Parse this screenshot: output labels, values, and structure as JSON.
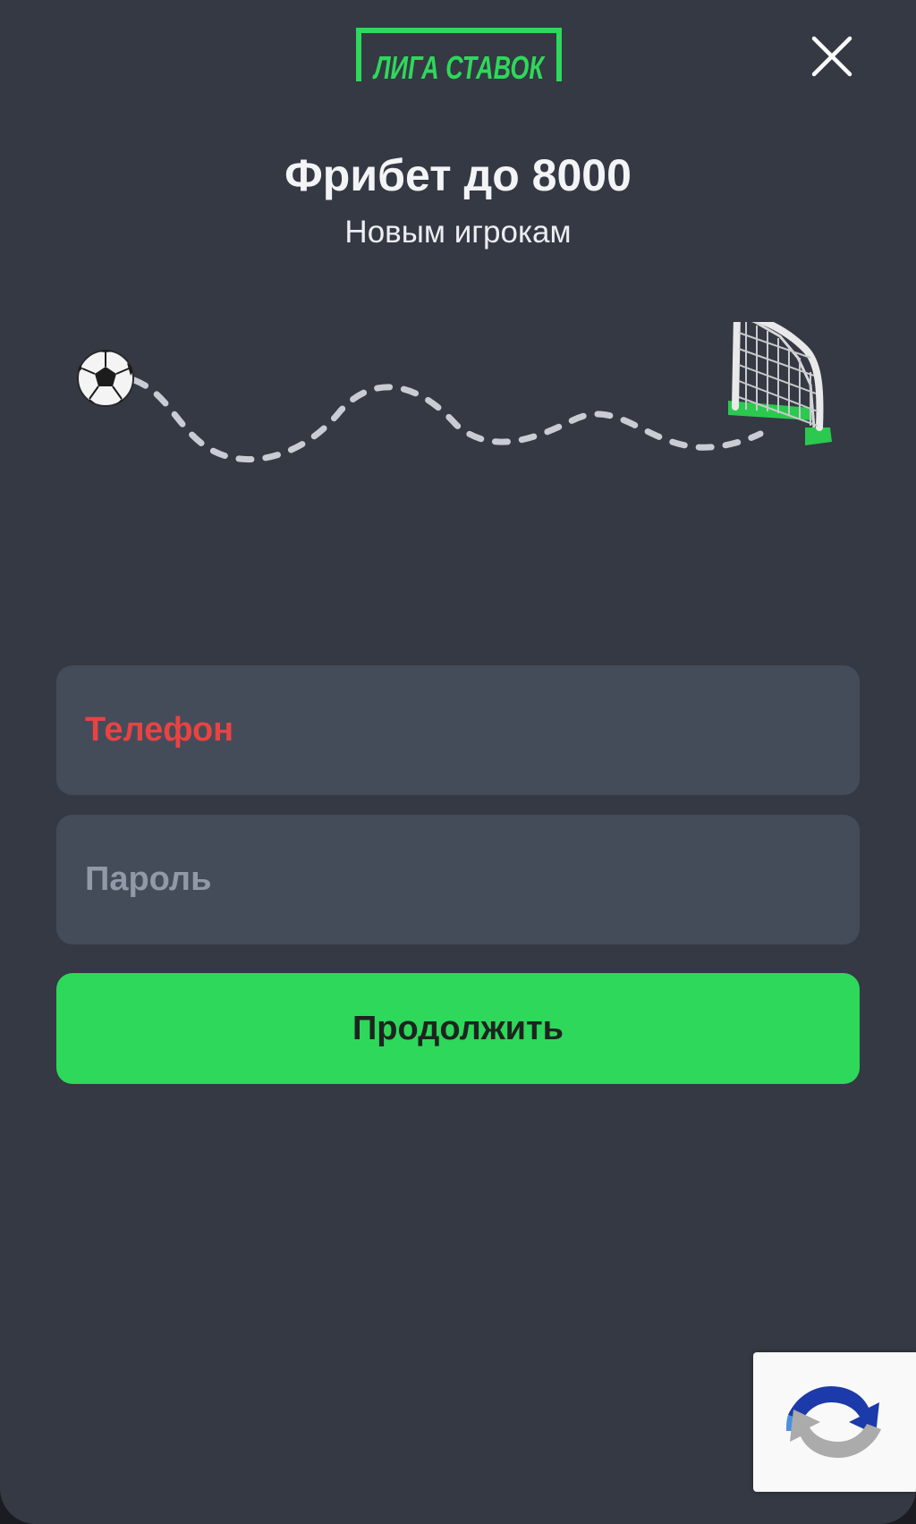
{
  "brand": {
    "logo_text": "ЛИГА СТАВОК",
    "accent_color": "#2ed85a"
  },
  "header": {
    "close_icon": "close-icon"
  },
  "promo": {
    "title": "Фрибет до 8000",
    "subtitle": "Новым игрокам"
  },
  "form": {
    "phone_placeholder": "Телефон",
    "password_placeholder": "Пароль",
    "phone_placeholder_color": "#e94242",
    "continue_label": "Продолжить"
  },
  "recaptcha": {
    "icon": "recaptcha-icon"
  }
}
